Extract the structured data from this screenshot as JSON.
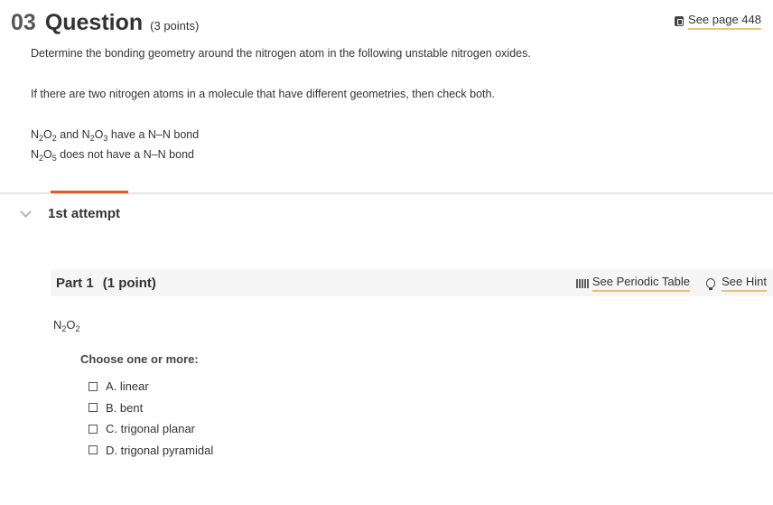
{
  "header": {
    "number": "03",
    "title": "Question",
    "points": "(3 points)",
    "see_page": "See page 448"
  },
  "question": {
    "line1": "Determine the bonding geometry around the nitrogen atom in the following unstable nitrogen oxides.",
    "line2": "If there are two nitrogen atoms in a molecule that have different geometries, then check both.",
    "note1": {
      "a": "N",
      "a_sub": "2",
      "b": "O",
      "b_sub": "2",
      "c": " and N",
      "c_sub": "2",
      "d": "O",
      "d_sub": "3",
      "e": " have a N–N bond"
    },
    "note2": {
      "a": "N",
      "a_sub": "2",
      "b": "O",
      "b_sub": "5",
      "e": " does not have a N–N bond"
    }
  },
  "attempt": {
    "label": "1st attempt"
  },
  "part": {
    "title": "Part 1",
    "points": "(1 point)",
    "periodic_table": "See Periodic Table",
    "hint": "See Hint",
    "formula": {
      "a": "N",
      "a_sub": "2",
      "b": "O",
      "b_sub": "2"
    },
    "prompt": "Choose one or more:",
    "options": [
      {
        "label": "A. linear"
      },
      {
        "label": "B. bent"
      },
      {
        "label": "C. trigonal planar"
      },
      {
        "label": "D. trigonal pyramidal"
      }
    ]
  },
  "colors": {
    "accent": "#e05a2b",
    "link_underline": "#e8c27a",
    "part_bar": "#f5f5f5"
  }
}
